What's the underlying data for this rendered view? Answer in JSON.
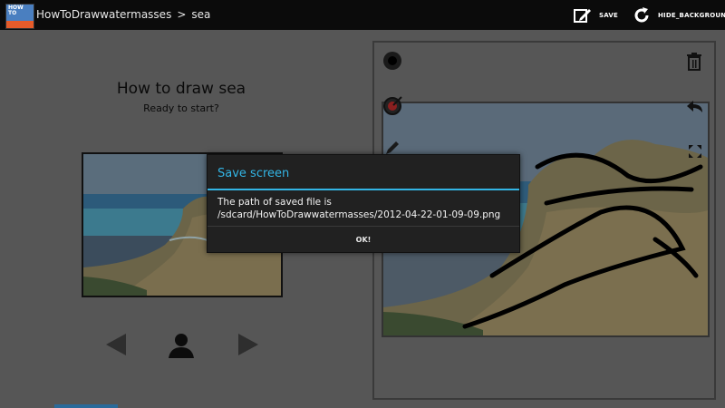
{
  "actionbar": {
    "app_icon_text": "HOW TO",
    "breadcrumb": [
      "HowToDrawwatermasses",
      ">",
      "sea"
    ],
    "save_label": "SAVE",
    "save_icon": "pencil-save-icon",
    "hide_background_label": "HIDE_BACKGROUND",
    "hide_background_icon": "refresh-icon"
  },
  "lesson": {
    "title": "How to draw sea",
    "subtitle": "Ready to start?",
    "prev_icon": "arrow-left-icon",
    "user_icon": "person-icon",
    "next_icon": "arrow-right-icon"
  },
  "tools": {
    "brush_size_icon": "brush-size-icon",
    "color_icon": "color-picker-icon",
    "pencil_icon": "pencil-icon",
    "trash_icon": "trash-icon",
    "undo_icon": "undo-icon",
    "expand_icon": "expand-icon"
  },
  "dialog": {
    "title": "Save screen",
    "message_line1": "The path of saved file is",
    "message_line2": "/sdcard/HowToDrawwatermasses/2012-04-22-01-09-09.png",
    "ok_label": "OK!"
  },
  "colors": {
    "accent": "#33b5e5",
    "dim_background": "#565656",
    "dialog_background": "#212121"
  }
}
